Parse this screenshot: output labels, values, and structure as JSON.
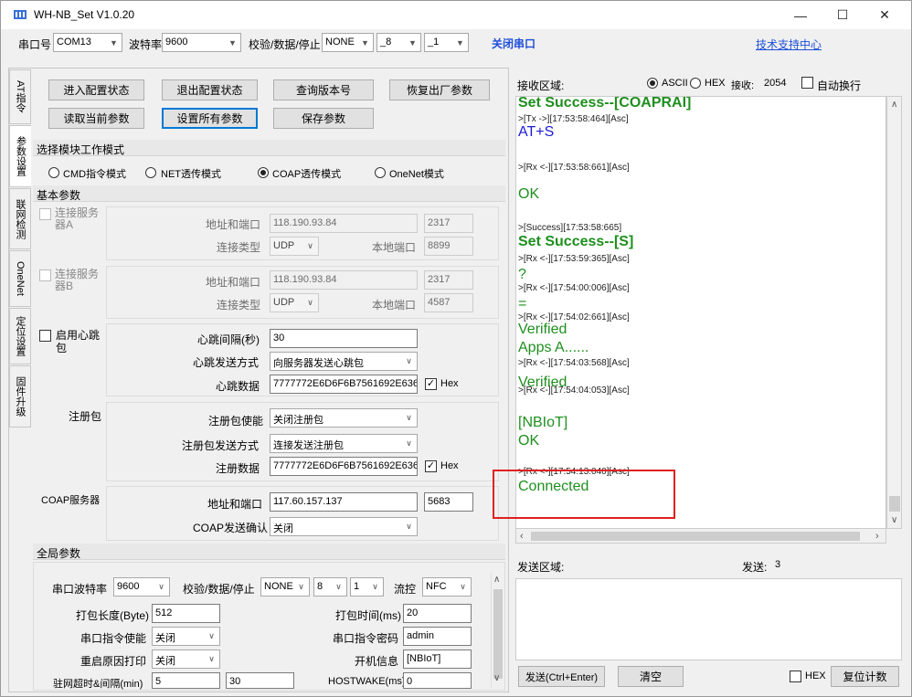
{
  "title": "WH-NB_Set V1.0.20",
  "window_controls": {
    "minimize": "—",
    "maximize": "☐",
    "close": "✕"
  },
  "toolbar": {
    "port_label": "串口号",
    "port_value": "COM13",
    "baud_label": "波特率",
    "baud_value": "9600",
    "check_label": "校验/数据/停止",
    "parity": "NONE",
    "databits": "_8",
    "stopbits": "_1",
    "close_port": "关闭串口",
    "support": "技术支持中心"
  },
  "tabs": [
    "AT指令",
    "参数设置",
    "联网检测",
    "OneNet",
    "定位设置",
    "固件升级"
  ],
  "buttons": {
    "enter_config": "进入配置状态",
    "exit_config": "退出配置状态",
    "query_version": "查询版本号",
    "factory_reset": "恢复出厂参数",
    "read_params": "读取当前参数",
    "set_all": "设置所有参数",
    "save_params": "保存参数"
  },
  "mode_section": {
    "title": "选择模块工作模式",
    "options": [
      "CMD指令模式",
      "NET透传模式",
      "COAP透传模式",
      "OneNet模式"
    ],
    "selected": "COAP透传模式"
  },
  "basic": {
    "title": "基本参数",
    "serverA": {
      "label": "连接服务器A",
      "addr_label": "地址和端口",
      "addr": "118.190.93.84",
      "port": "2317",
      "type_label": "连接类型",
      "type": "UDP",
      "local_label": "本地端口",
      "local": "8899"
    },
    "serverB": {
      "label": "连接服务器B",
      "addr_label": "地址和端口",
      "addr": "118.190.93.84",
      "port": "2317",
      "type_label": "连接类型",
      "type": "UDP",
      "local_label": "本地端口",
      "local": "4587"
    },
    "heartbeat": {
      "label": "启用心跳包",
      "interval_label": "心跳间隔(秒)",
      "interval": "30",
      "mode_label": "心跳发送方式",
      "mode": "向服务器发送心跳包",
      "data_label": "心跳数据",
      "data": "7777772E6D6F6B7561692E636E",
      "hex": "Hex"
    },
    "register": {
      "label": "注册包",
      "enable_label": "注册包使能",
      "enable": "关闭注册包",
      "mode_label": "注册包发送方式",
      "mode": "连接发送注册包",
      "data_label": "注册数据",
      "data": "7777772E6D6F6B7561692E636E",
      "hex": "Hex"
    },
    "coap": {
      "label": "COAP服务器",
      "addr_label": "地址和端口",
      "addr": "117.60.157.137",
      "port": "5683",
      "confirm_label": "COAP发送确认",
      "confirm": "关闭"
    }
  },
  "global": {
    "title": "全局参数",
    "baud_label": "串口波特率",
    "baud": "9600",
    "check_label": "校验/数据/停止",
    "parity": "NONE",
    "databits": "8",
    "stopbits": "1",
    "flow_label": "流控",
    "flow": "NFC",
    "pack_len_label": "打包长度(Byte)",
    "pack_len": "512",
    "pack_time_label": "打包时间(ms)",
    "pack_time": "20",
    "cmd_enable_label": "串口指令使能",
    "cmd_enable": "关闭",
    "cmd_pwd_label": "串口指令密码",
    "cmd_pwd": "admin",
    "reboot_label": "重启原因打印",
    "reboot": "关闭",
    "boot_label": "开机信息",
    "boot": "[NBIoT]",
    "net_timeout_label": "驻网超时&间隔(min)",
    "net_timeout": "5",
    "net_interval": "30",
    "hostwake_label": "HOSTWAKE(ms)",
    "hostwake": "0"
  },
  "receive": {
    "label": "接收区域:",
    "ascii": "ASCII",
    "hex": "HEX",
    "count_label": "接收:",
    "count": "2054",
    "autowrap": "自动换行",
    "log": [
      {
        "t": "greenb",
        "text": "Set Success--[COAPRAI]"
      },
      {
        "t": "meta",
        "text": ">[Tx ->][17:53:58:464][Asc]"
      },
      {
        "t": "blue",
        "text": "AT+S"
      },
      {
        "t": "meta",
        "text": ">[Rx <-][17:53:58:661][Asc]"
      },
      {
        "t": "green",
        "text": "OK"
      },
      {
        "t": "meta",
        "text": ">[Success][17:53:58:665]"
      },
      {
        "t": "greenb",
        "text": "Set Success--[S]"
      },
      {
        "t": "meta",
        "text": ">[Rx <-][17:53:59:365][Asc]"
      },
      {
        "t": "green",
        "text": "?"
      },
      {
        "t": "meta",
        "text": ">[Rx <-][17:54:00:006][Asc]"
      },
      {
        "t": "green",
        "text": "="
      },
      {
        "t": "meta",
        "text": ">[Rx <-][17:54:02:661][Asc]"
      },
      {
        "t": "green",
        "text": "Verified"
      },
      {
        "t": "green",
        "text": "Apps A......"
      },
      {
        "t": "meta",
        "text": ">[Rx <-][17:54:03:568][Asc]"
      },
      {
        "t": "green",
        "text": "Verified"
      },
      {
        "t": "meta",
        "text": ">[Rx <-][17:54:04:053][Asc]"
      },
      {
        "t": "green",
        "text": "[NBIoT]"
      },
      {
        "t": "green",
        "text": "OK"
      },
      {
        "t": "meta",
        "text": ">[Rx <-][17:54:13:040][Asc]"
      },
      {
        "t": "green",
        "text": "Connected"
      }
    ]
  },
  "send": {
    "label": "发送区域:",
    "count_label": "发送:",
    "count": "3",
    "send_btn": "发送(Ctrl+Enter)",
    "clear_btn": "清空",
    "hex": "HEX",
    "reset_btn": "复位计数"
  },
  "colors": {
    "highlight": "#e02020",
    "green": "#1e8f1e",
    "blue": "#1c1cd4"
  }
}
